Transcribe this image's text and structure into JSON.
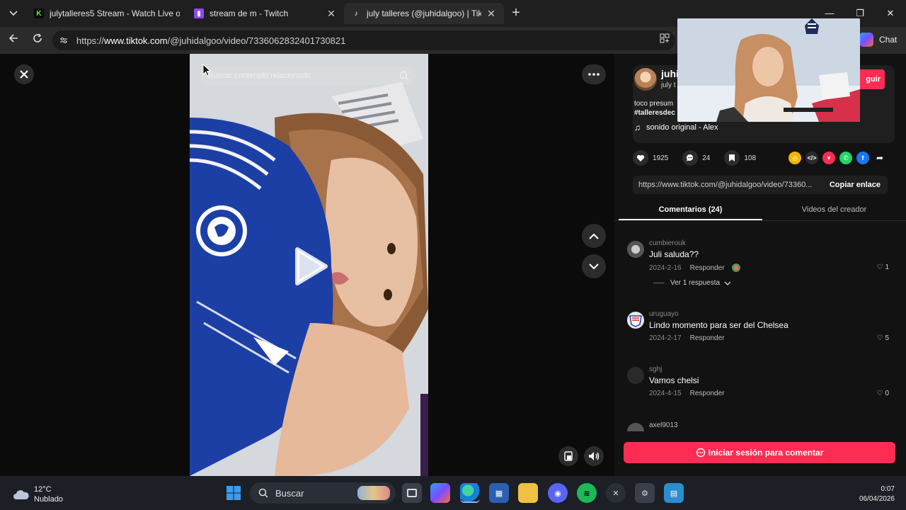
{
  "browser": {
    "tabs": [
      {
        "title": "julytalleres5 Stream - Watch Live o",
        "favicon": "kick-icon",
        "color": "#53fc18"
      },
      {
        "title": "stream de m - Twitch",
        "favicon": "twitch-icon",
        "color": "#9146ff"
      },
      {
        "title": "july talleres (@juhidalgoo) | TikTok",
        "favicon": "tiktok-icon",
        "color": "#ffffff"
      }
    ],
    "url_prefix": "https://",
    "url_domain": "www.tiktok.com",
    "url_path": "/@juhidalgoo/video/7336062832401730821",
    "copilot_label": "Chat"
  },
  "player": {
    "search_placeholder": "Buscar contenido relacionado"
  },
  "author": {
    "name": "juhi",
    "subtitle": "july t",
    "follow_label": "guir",
    "desc_line1": "toco presum",
    "desc_line2": "#talleresdec",
    "sound": "sonido original - Alex"
  },
  "stats": {
    "likes": "1925",
    "comments": "24",
    "saves": "108"
  },
  "link": {
    "url": "https://www.tiktok.com/@juhidalgoo/video/73360...",
    "copy_label": "Copiar enlace"
  },
  "panel_tabs": {
    "comments": "Comentarios (24)",
    "creator_videos": "Videos del creador"
  },
  "comments": [
    {
      "user": "cumbierouk",
      "text": "Juli saluda??",
      "date": "2024-2-16",
      "reply": "Responder",
      "likes": "1"
    },
    {
      "user": "uruguayo",
      "text": "Lindo momento para ser del Chelsea",
      "date": "2024-2-17",
      "reply": "Responder",
      "likes": "5"
    },
    {
      "user": "sghj",
      "text": "Vamos chelsi",
      "date": "2024-4-15",
      "reply": "Responder",
      "likes": "0"
    },
    {
      "user": "axel9013",
      "text": "",
      "date": "",
      "reply": "",
      "likes": ""
    }
  ],
  "replies_label": "Ver 1 respuesta",
  "login_label": "Iniciar sesión para comentar",
  "taskbar": {
    "temperature": "12°C",
    "condition": "Nublado",
    "search_label": "Buscar",
    "time": "0:07",
    "date": "06/04/2026"
  },
  "colors": {
    "accent": "#fe2c55",
    "background": "#121212"
  }
}
